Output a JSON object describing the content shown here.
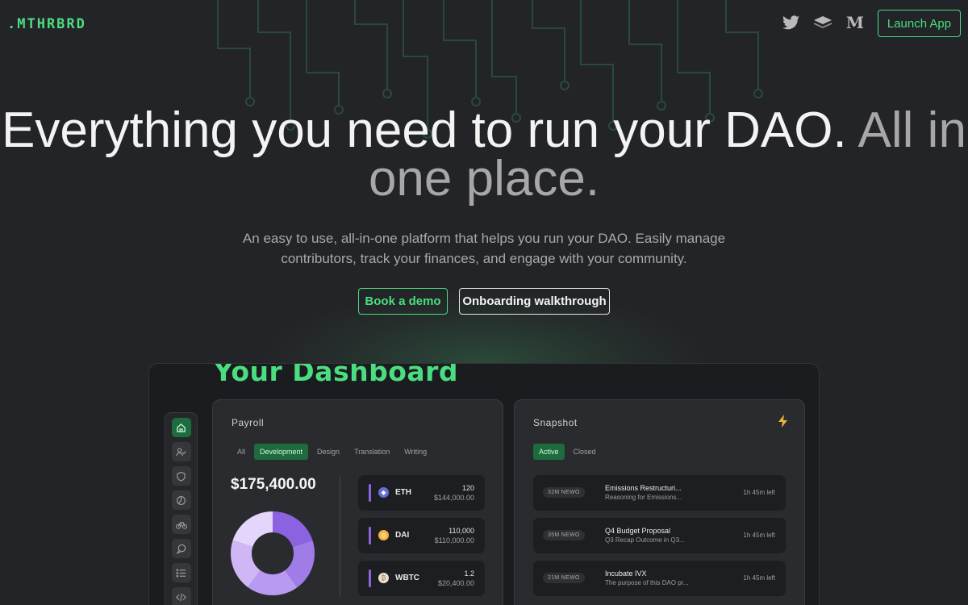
{
  "header": {
    "logo": ".MTHRBRD",
    "icons": [
      "twitter-icon",
      "gitbook-icon",
      "medium-icon"
    ],
    "medium_glyph": "M",
    "launch_label": "Launch App"
  },
  "hero": {
    "title_main": "Everything you need to run your DAO.",
    "title_dim": "All in one place.",
    "subtitle": "An easy to use, all-in-one platform that helps you run your DAO. Easily manage contributors, track your finances, and engage with your community.",
    "demo_label": "Book a demo",
    "walkthrough_label": "Onboarding walkthrough"
  },
  "dashboard": {
    "title": "Your Dashboard",
    "sidebar_icons": [
      "home-icon",
      "users-icon",
      "shield-icon",
      "pie-chart-icon",
      "bike-icon",
      "chat-icon",
      "list-icon",
      "code-icon"
    ],
    "payroll": {
      "title": "Payroll",
      "tabs": [
        "All",
        "Development",
        "Design",
        "Translation",
        "Writing"
      ],
      "active_tab": "Development",
      "total": "$175,400.00",
      "donut_colors": [
        "#8b63e0",
        "#a07ce8",
        "#b89af0",
        "#cfb6f5",
        "#e4d6fa"
      ],
      "tokens": [
        {
          "symbol": "ETH",
          "qty": "120",
          "value": "$144,000.00",
          "icon_color": "#6270d6",
          "glyph": "◆"
        },
        {
          "symbol": "DAI",
          "qty": "110,000",
          "value": "$110,000.00",
          "icon_color": "#f2b33d",
          "glyph": "◎"
        },
        {
          "symbol": "WBTC",
          "qty": "1.2",
          "value": "$20,400.00",
          "icon_color": "#e8e0d2",
          "glyph": "₿"
        }
      ]
    },
    "snapshot": {
      "title": "Snapshot",
      "tabs": [
        "Active",
        "Closed"
      ],
      "active_tab": "Active",
      "proposals": [
        {
          "badge": "32M NEWO",
          "title": "Emissions Restructuri...",
          "desc": "Reasoning for Emissions...",
          "time": "1h 45m left"
        },
        {
          "badge": "35M NEWO",
          "title": "Q4 Budget Proposal",
          "desc": "Q3 Recap Outcome in Q3...",
          "time": "1h 45m left"
        },
        {
          "badge": "21M NEWO",
          "title": "Incubate IVX",
          "desc": "The purpose of this DAO pr...",
          "time": "1h 45m left"
        }
      ]
    }
  }
}
